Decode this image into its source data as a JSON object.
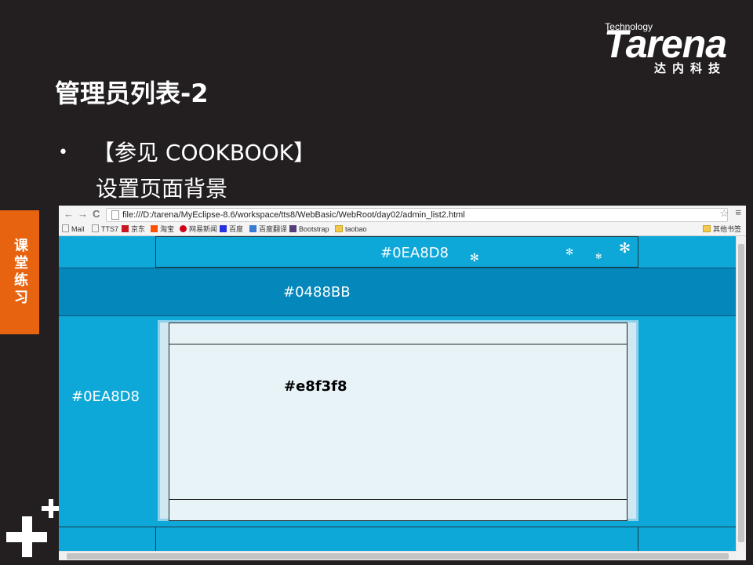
{
  "slide": {
    "title": "管理员列表-2",
    "bullet_symbol": "•",
    "bullet_line1": "【参见 COOKBOOK】",
    "bullet_line2": "设置页面背景",
    "side_tab": "课堂练习"
  },
  "logo": {
    "small_text": "Technology",
    "word": "Tarena",
    "chinese": "达内科技"
  },
  "browser": {
    "back_icon": "←",
    "forward_icon": "→",
    "reload_icon": "C",
    "url": "file:///D:/tarena/MyEclipse-8.6/workspace/tts8/WebBasic/WebRoot/day02/admin_list2.html",
    "star_icon": "☆",
    "menu_icon": "≡",
    "bookmarks": [
      {
        "label": "Mail",
        "icon": "page-icon"
      },
      {
        "label": "TTS7",
        "icon": "page-icon"
      },
      {
        "label": "京东",
        "icon": "jd-icon"
      },
      {
        "label": "淘宝",
        "icon": "taobao-icon"
      },
      {
        "label": "网易新闻",
        "icon": "netease-icon"
      },
      {
        "label": "百度",
        "icon": "baidu-icon"
      },
      {
        "label": "百度翻译",
        "icon": "translate-icon"
      },
      {
        "label": "Bootstrap",
        "icon": "bootstrap-icon"
      },
      {
        "label": "taobao",
        "icon": "folder-icon"
      }
    ],
    "other_bookmarks": "其他书签"
  },
  "page": {
    "top_label": "#0EA8D8",
    "nav_label": "#0488BB",
    "side_label": "#0EA8D8",
    "content_label": "#e8f3f8"
  },
  "colors": {
    "slide_bg": "#231f20",
    "accent_orange": "#e8630f",
    "page_bg": "#0ea8d8",
    "nav_bg": "#0488bb",
    "content_bg": "#e8f3f8"
  }
}
